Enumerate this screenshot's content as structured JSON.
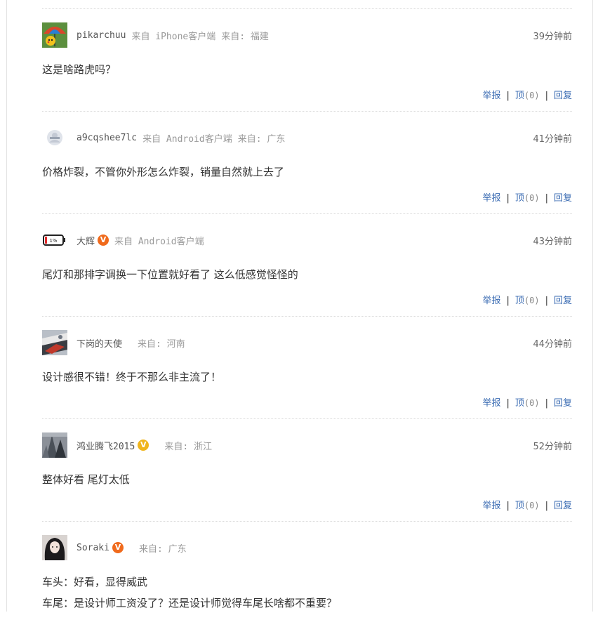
{
  "comments": [
    {
      "username": "pikarchuu",
      "verified": false,
      "source": "来自 iPhone客户端",
      "location": "来自: 福建",
      "time": "39分钟前",
      "content": [
        "这是啥路虎吗？"
      ],
      "avatar": "pikachu-umbrella-avatar"
    },
    {
      "username": "a9cqshee7lc",
      "verified": false,
      "source": "来自 Android客户端",
      "location": "来自: 广东",
      "time": "41分钟前",
      "content": [
        "价格炸裂，不管你外形怎么炸裂，销量自然就上去了"
      ],
      "avatar": "default-avatar"
    },
    {
      "username": "大辉",
      "verified": true,
      "verified_color": "#f06a1c",
      "source": "来自 Android客户端",
      "location": "",
      "time": "43分钟前",
      "content": [
        "尾灯和那排字调换一下位置就好看了 这么低感觉怪怪的"
      ],
      "avatar": "battery-avatar",
      "avatar_text": "1%"
    },
    {
      "username": "下岗的天使",
      "verified": false,
      "source": "",
      "location": "来自: 河南",
      "time": "44分钟前",
      "content": [
        "设计感很不错！终于不那么非主流了！"
      ],
      "avatar": "photo-avatar"
    },
    {
      "username": "鸿业腾飞2015",
      "verified": true,
      "verified_color": "#f0b51c",
      "source": "",
      "location": "来自: 浙江",
      "time": "52分钟前",
      "content": [
        "整体好看 尾灯太低"
      ],
      "avatar": "building-avatar"
    },
    {
      "username": "Soraki",
      "verified": true,
      "verified_color": "#f06a1c",
      "source": "",
      "location": "来自: 广东",
      "time": "",
      "content": [
        "车头：好看，显得威武",
        "车尾：是设计师工资没了？还是设计师觉得车尾长啥都不重要？"
      ],
      "avatar": "girl-avatar"
    }
  ],
  "actions": {
    "report": "举报",
    "up": "顶",
    "up_count": "(0)",
    "reply": "回复",
    "separator": "|"
  },
  "badge_glyph": "V"
}
